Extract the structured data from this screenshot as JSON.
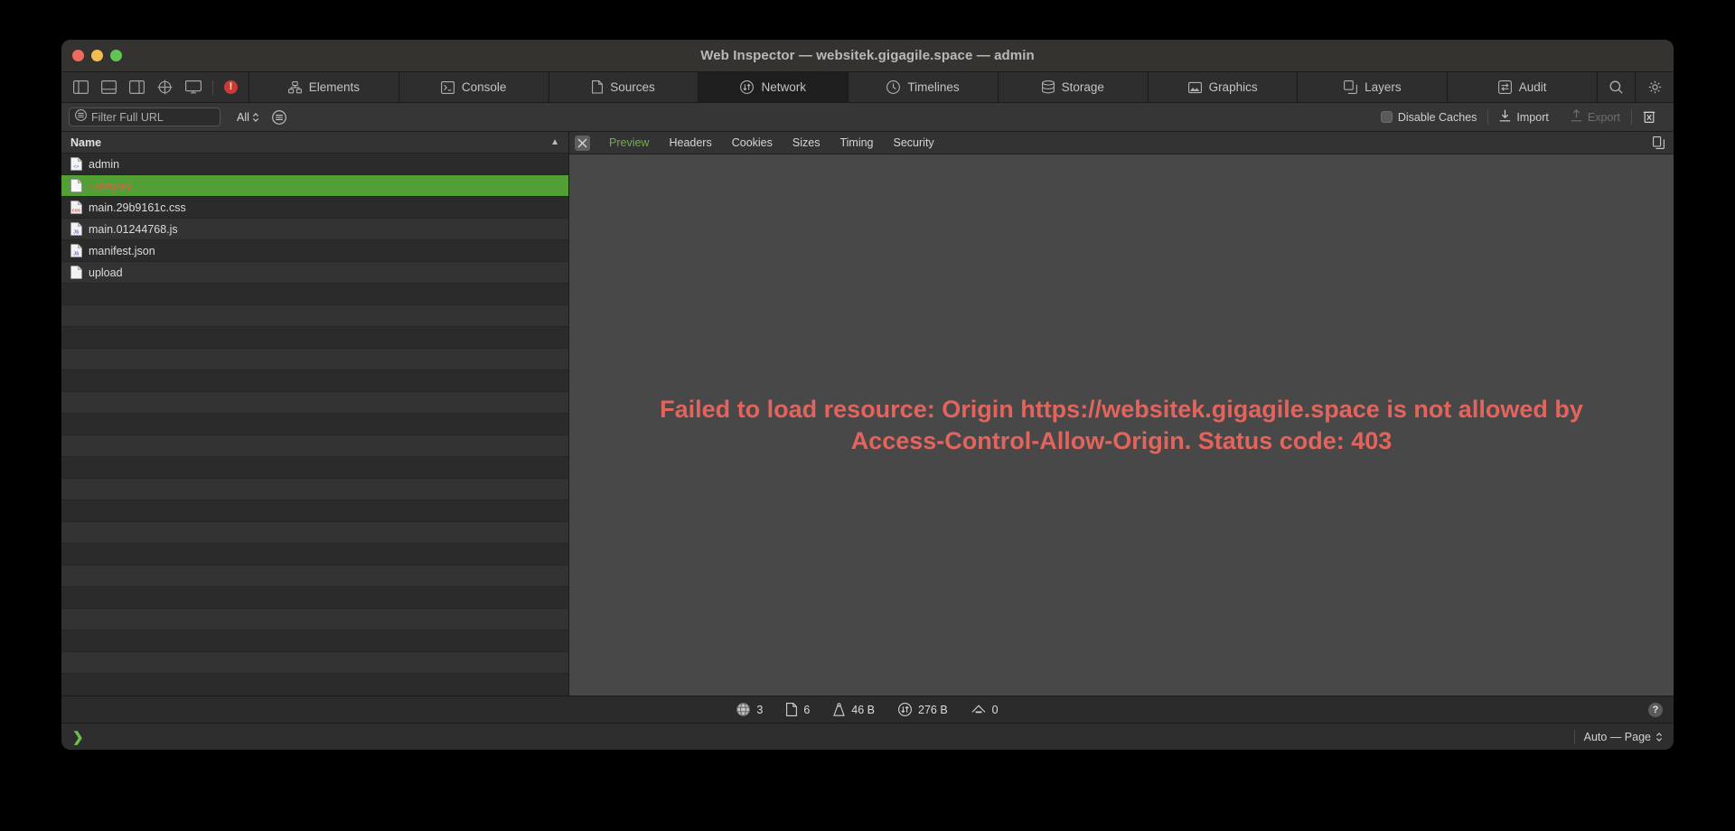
{
  "window": {
    "title": "Web Inspector — websitek.gigagile.space — admin",
    "traffic_lights": [
      "close",
      "minimize",
      "zoom"
    ]
  },
  "toolbar": {
    "buttons": [
      {
        "name": "toggle-left-sidebar",
        "icon": "left-sidebar-icon"
      },
      {
        "name": "toggle-bottom-panel",
        "icon": "bottom-panel-icon"
      },
      {
        "name": "toggle-right-sidebar",
        "icon": "right-sidebar-icon"
      },
      {
        "name": "inspect-element",
        "icon": "crosshair-icon"
      },
      {
        "name": "device-mode",
        "icon": "display-icon"
      }
    ],
    "error_badge": "!",
    "error_badge_color": "#cc3a33"
  },
  "tabs": [
    {
      "label": "Elements",
      "icon": "elements-icon",
      "selected": false
    },
    {
      "label": "Console",
      "icon": "console-icon",
      "selected": false
    },
    {
      "label": "Sources",
      "icon": "sources-icon",
      "selected": false
    },
    {
      "label": "Network",
      "icon": "network-icon",
      "selected": true
    },
    {
      "label": "Timelines",
      "icon": "clock-icon",
      "selected": false
    },
    {
      "label": "Storage",
      "icon": "database-icon",
      "selected": false
    },
    {
      "label": "Graphics",
      "icon": "image-icon",
      "selected": false
    },
    {
      "label": "Layers",
      "icon": "layers-icon",
      "selected": false
    },
    {
      "label": "Audit",
      "icon": "audit-icon",
      "selected": false
    }
  ],
  "tabbar_right": [
    {
      "name": "search-icon"
    },
    {
      "name": "gear-icon"
    }
  ],
  "filterbar": {
    "filter_placeholder": "Filter Full URL",
    "filter_value": "",
    "filter_icon": "filter-icon",
    "type_select": "All",
    "filter_toggle_icon": "filter-settings-icon",
    "disable_caches_label": "Disable Caches",
    "disable_caches_checked": false,
    "import_label": "Import",
    "export_label": "Export",
    "export_disabled": true,
    "clear_icon": "trash-icon"
  },
  "resource_list": {
    "column_header": "Name",
    "sort_indicator": "▲",
    "selected_row_bg": "#519f35",
    "selected_row_text": "#e8584c",
    "rows": [
      {
        "name": "admin",
        "type": "html",
        "selected": false
      },
      {
        "name": "category",
        "type": "document",
        "selected": true
      },
      {
        "name": "main.29b9161c.css",
        "type": "css",
        "selected": false
      },
      {
        "name": "main.01244768.js",
        "type": "js",
        "selected": false
      },
      {
        "name": "manifest.json",
        "type": "js",
        "selected": false
      },
      {
        "name": "upload",
        "type": "document",
        "selected": false
      }
    ]
  },
  "detail": {
    "close_icon": "close-icon",
    "copy_icon": "copy-icon",
    "tabs": [
      {
        "label": "Preview",
        "active": true
      },
      {
        "label": "Headers",
        "active": false
      },
      {
        "label": "Cookies",
        "active": false
      },
      {
        "label": "Sizes",
        "active": false
      },
      {
        "label": "Timing",
        "active": false
      },
      {
        "label": "Security",
        "active": false
      }
    ],
    "active_tab_color": "#6fb04a",
    "error_message": "Failed to load resource: Origin https://websitek.gigagile.space is not allowed by Access-Control-Allow-Origin. Status code: 403",
    "error_color": "#e2645c"
  },
  "statusbar": {
    "stats": [
      {
        "icon": "globe-icon",
        "value": "3"
      },
      {
        "icon": "document-icon",
        "value": "6"
      },
      {
        "icon": "weight-icon",
        "value": "46 B"
      },
      {
        "icon": "transfer-icon",
        "value": "276 B"
      },
      {
        "icon": "cache-icon",
        "value": "0"
      }
    ],
    "help_label": "?"
  },
  "console": {
    "prompt": "❯",
    "prompt_color": "#6fc04a",
    "context_label": "Auto — Page"
  }
}
